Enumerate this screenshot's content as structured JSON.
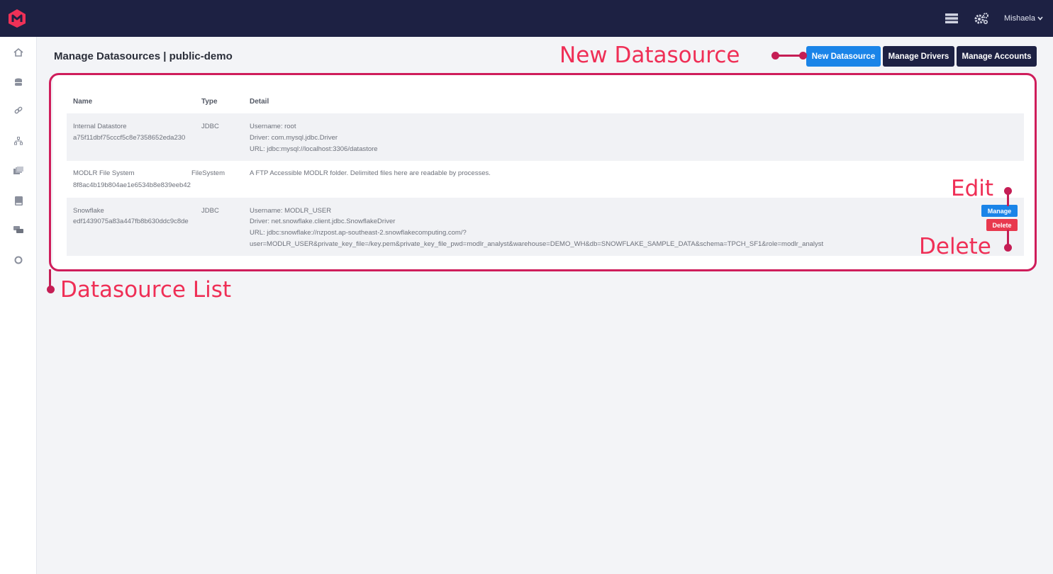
{
  "header": {
    "user": "Mishaela",
    "icons": [
      "logo-icon",
      "server-icon",
      "gears-icon",
      "chevron-down-icon"
    ]
  },
  "sidebar": {
    "items": [
      "home-icon",
      "database-icon",
      "link-icon",
      "sitemap-icon",
      "folder-icon",
      "book-icon",
      "comments-icon",
      "lifering-icon"
    ]
  },
  "page": {
    "title": "Manage Datasources | public-demo"
  },
  "toolbar": {
    "new_datasource": "New Datasource",
    "manage_drivers": "Manage Drivers",
    "manage_accounts": "Manage Accounts"
  },
  "table": {
    "headers": [
      "Name",
      "Type",
      "Detail"
    ],
    "rows": [
      {
        "name": "Internal Datastore",
        "id": "a75f11dbf75cccf5c8e7358652eda230",
        "type": "JDBC",
        "detail": [
          "Username: root",
          "Driver: com.mysql.jdbc.Driver",
          "URL: jdbc:mysql://localhost:3306/datastore"
        ]
      },
      {
        "name": "MODLR File System",
        "id": "8f8ac4b19b804ae1e6534b8e839eeb42",
        "type": "FileSystem",
        "detail": [
          "A FTP Accessible MODLR folder. Delimited files here are readable by processes."
        ]
      },
      {
        "name": "Snowflake",
        "id": "edf1439075a83a447fb8b630ddc9c8de",
        "type": "JDBC",
        "detail": [
          "Username: MODLR_USER",
          "Driver: net.snowflake.client.jdbc.SnowflakeDriver",
          "URL: jdbc:snowflake://nzpost.ap-southeast-2.snowflakecomputing.com/?",
          "user=MODLR_USER&private_key_file=/key.pem&private_key_file_pwd=modlr_analyst&warehouse=DEMO_WH&db=SNOWFLAKE_SAMPLE_DATA&schema=TPCH_SF1&role=modlr_analyst"
        ],
        "actions": {
          "manage": "Manage",
          "delete": "Delete"
        }
      }
    ]
  },
  "annotations": {
    "new_datasource": "New Datasource",
    "edit": "Edit",
    "delete": "Delete",
    "datasource_list": "Datasource List"
  },
  "colors": {
    "topbar": "#1d2143",
    "primary": "#1a84e8",
    "danger": "#e8394e",
    "annotation": "#ef2f56",
    "annotation_line": "#c51e55"
  }
}
